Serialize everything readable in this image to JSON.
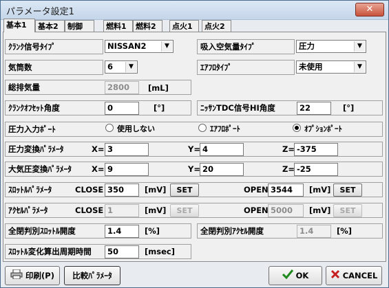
{
  "window": {
    "title": "パラメータ設定1",
    "close": "✕"
  },
  "tabs": [
    "基本1",
    "基本2",
    "制御",
    "燃料1",
    "燃料2",
    "点火1",
    "点火2"
  ],
  "row1": {
    "label": "ｸﾗﾝｸ信号ﾀｲﾌﾟ",
    "value": "NISSAN2",
    "label2": "吸入空気量ﾀｲﾌﾟ",
    "value2": "圧力"
  },
  "row2": {
    "label": "気筒数",
    "value": "6",
    "label2": "ｴｱﾌﾛﾀｲﾌﾟ",
    "value2": "未使用"
  },
  "row3": {
    "label": "総排気量",
    "value": "2800",
    "unit": "[mL]"
  },
  "row4": {
    "label": "ｸﾗﾝｸｵﾌｾｯﾄ角度",
    "value": "0",
    "unit": "[°]",
    "label2": "ﾆｯｻﾝTDC信号HI角度",
    "value2": "22",
    "unit2": "[°]"
  },
  "row5": {
    "label": "圧力入力ﾎﾟｰﾄ",
    "opts": [
      "使用しない",
      "ｴｱﾌﾛﾎﾟｰﾄ",
      "ｵﾌﾟｼｮﾝﾎﾟｰﾄ"
    ],
    "selected": 2
  },
  "row6": {
    "label": "圧力変換ﾊﾟﾗﾒｰﾀ",
    "xl": "X=",
    "x": "3",
    "yl": "Y=",
    "y": "4",
    "zl": "Z=",
    "z": "-375"
  },
  "row7": {
    "label": "大気圧変換ﾊﾟﾗﾒｰﾀ",
    "xl": "X=",
    "x": "9",
    "yl": "Y=",
    "y": "20",
    "zl": "Z=",
    "z": "-25"
  },
  "row8": {
    "label": "ｽﾛｯﾄﾙﾊﾟﾗﾒｰﾀ",
    "close": "CLOSE",
    "cv": "350",
    "cu": "[mV]",
    "set": "SET",
    "open": "OPEN",
    "ov": "3544",
    "ou": "[mV]",
    "set2": "SET"
  },
  "row9": {
    "label": "ｱｸｾﾙﾊﾟﾗﾒｰﾀ",
    "close": "CLOSE",
    "cv": "1",
    "cu": "[mV]",
    "set": "SET",
    "open": "OPEN",
    "ov": "5000",
    "ou": "[mV]",
    "set2": "SET"
  },
  "row10": {
    "label": "全閉判別ｽﾛｯﾄﾙ開度",
    "value": "1.4",
    "unit": "[%]",
    "label2": "全閉判別ｱｸｾﾙ開度",
    "value2": "1.4",
    "unit2": "[%]"
  },
  "row11": {
    "label": "ｽﾛｯﾄﾙ変化算出周期時間",
    "value": "50",
    "unit": "[msec]"
  },
  "bottom": {
    "print": "印刷(P)",
    "compare": "比較ﾊﾟﾗﾒｰﾀ",
    "ok": "OK",
    "cancel": "CANCEL"
  }
}
